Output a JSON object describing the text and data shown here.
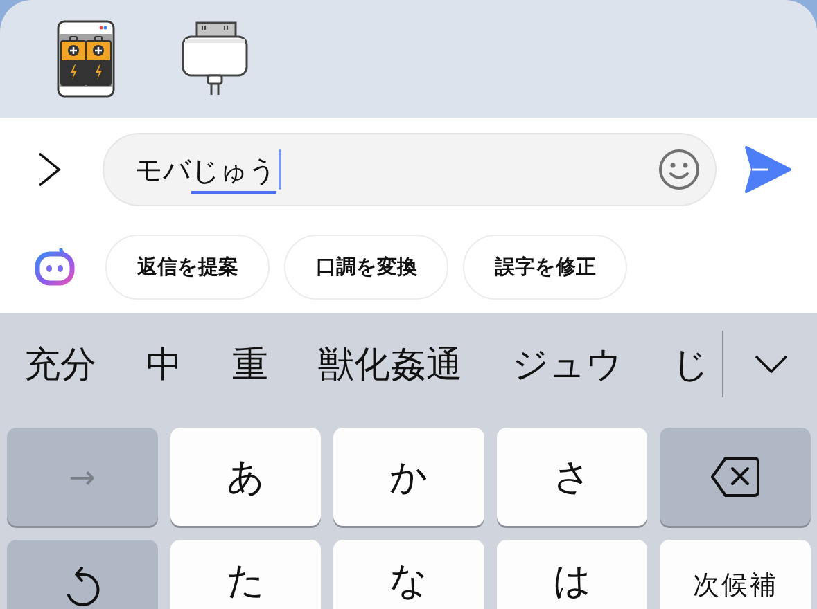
{
  "composer": {
    "value": "モバ",
    "composing": "じゅう"
  },
  "ai_actions": [
    {
      "label": "返信を提案"
    },
    {
      "label": "口調を変換"
    },
    {
      "label": "誤字を修正"
    }
  ],
  "candidates": [
    "充分",
    "中",
    "重",
    "獣化姦通",
    "ジュウ",
    "じ"
  ],
  "keyboard": {
    "rows": [
      [
        {
          "kind": "arrow",
          "label": "→"
        },
        {
          "kind": "char",
          "label": "あ"
        },
        {
          "kind": "char",
          "label": "か"
        },
        {
          "kind": "char",
          "label": "さ"
        },
        {
          "kind": "backspace"
        }
      ],
      [
        {
          "kind": "undo"
        },
        {
          "kind": "char",
          "label": "た"
        },
        {
          "kind": "char",
          "label": "な"
        },
        {
          "kind": "char",
          "label": "は"
        },
        {
          "kind": "action",
          "label": "次候補"
        }
      ]
    ]
  }
}
